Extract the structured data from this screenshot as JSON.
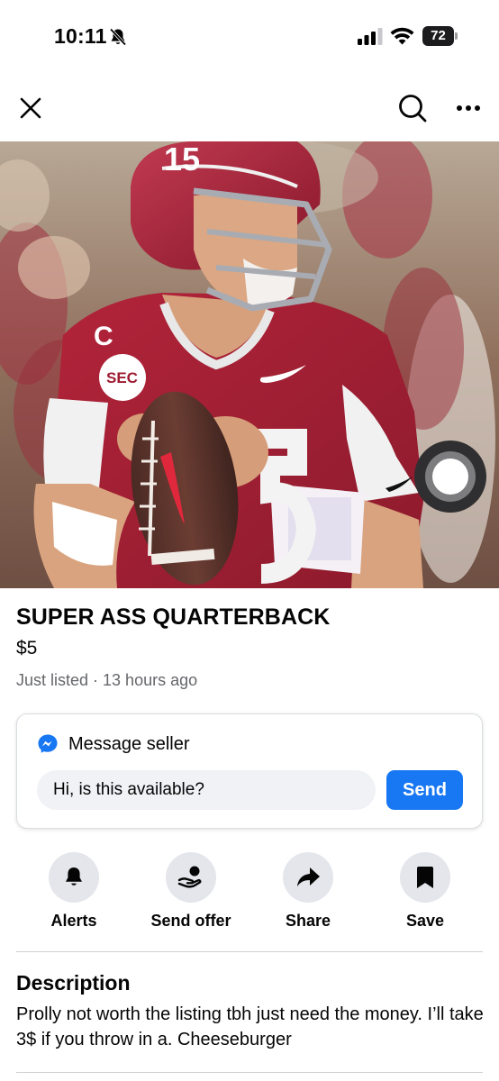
{
  "status_bar": {
    "time": "10:11",
    "battery": "72"
  },
  "nav": {
    "icons": [
      "close-icon",
      "search-icon",
      "more-icon"
    ]
  },
  "listing": {
    "title": "SUPER ASS QUARTERBACK",
    "price": "$5",
    "meta": "Just listed · 13 hours ago"
  },
  "message": {
    "label": "Message seller",
    "input_value": "Hi, is this available?",
    "send_label": "Send"
  },
  "actions": [
    {
      "label": "Alerts",
      "icon": "bell-icon"
    },
    {
      "label": "Send offer",
      "icon": "offer-icon"
    },
    {
      "label": "Share",
      "icon": "share-icon"
    },
    {
      "label": "Save",
      "icon": "bookmark-icon"
    }
  ],
  "description": {
    "heading": "Description",
    "body": "Prolly not worth the listing tbh just need the money. I’ll take 3$ if you throw in a. Cheeseburger"
  },
  "colors": {
    "accent": "#1877f2",
    "secondary_text": "#65676b",
    "button_bg": "#e4e6eb",
    "jersey": "#9e1b32"
  }
}
